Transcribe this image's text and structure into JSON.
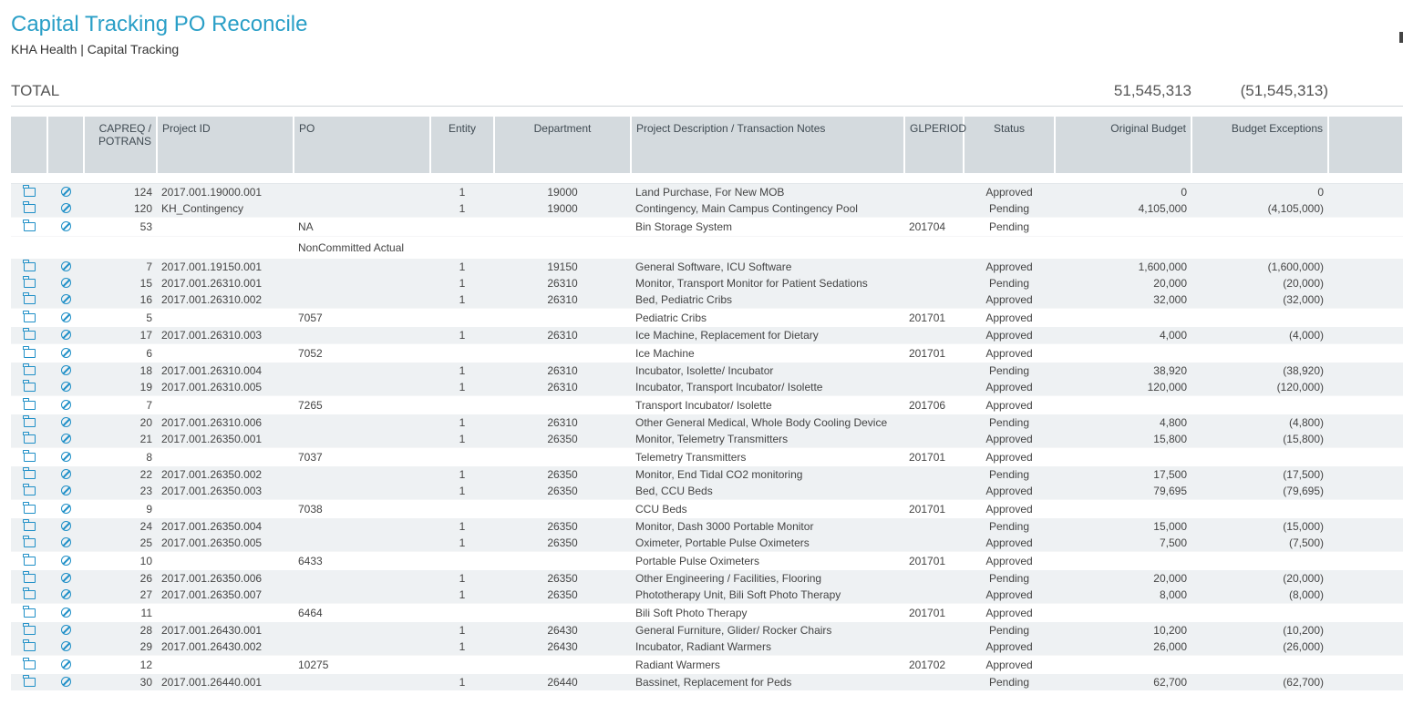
{
  "header": {
    "title": "Capital Tracking PO Reconcile",
    "subtitle": "KHA Health | Capital Tracking"
  },
  "totals": {
    "label": "TOTAL",
    "original_budget": "51,545,313",
    "budget_exceptions": "(51,545,313)"
  },
  "columns": {
    "capreq": "CAPREQ / POTRANS",
    "project_id": "Project ID",
    "po": "PO",
    "entity": "Entity",
    "department": "Department",
    "description": "Project Description / Transaction Notes",
    "glperiod": "GLPERIOD",
    "status": "Status",
    "original_budget": "Original Budget",
    "budget_exceptions": "Budget Exceptions"
  },
  "icons": {
    "open": "folder-open-icon",
    "cancel": "ban-icon",
    "color": "#1e8fc7"
  },
  "rows": [
    {
      "kind": "g",
      "capreq": "124",
      "project_id": "2017.001.19000.001",
      "po": "",
      "entity": "1",
      "department": "19000",
      "description": "Land Purchase, For New MOB",
      "glperiod": "",
      "status": "Approved",
      "original_budget": "0",
      "budget_exceptions": "0"
    },
    {
      "kind": "g",
      "capreq": "120",
      "project_id": "KH_Contingency",
      "po": "",
      "entity": "1",
      "department": "19000",
      "description": "Contingency, Main Campus Contingency Pool",
      "glperiod": "",
      "status": "Pending",
      "original_budget": "4,105,000",
      "budget_exceptions": "(4,105,000)"
    },
    {
      "kind": "w",
      "capreq": "53",
      "project_id": "",
      "po": "NA",
      "entity": "",
      "department": "",
      "description": "Bin Storage System",
      "glperiod": "201704",
      "status": "Pending",
      "original_budget": "",
      "budget_exceptions": ""
    },
    {
      "kind": "n",
      "capreq": "",
      "project_id": "",
      "po": "NonCommitted Actual",
      "entity": "",
      "department": "",
      "description": "",
      "glperiod": "",
      "status": "",
      "original_budget": "",
      "budget_exceptions": ""
    },
    {
      "kind": "g",
      "capreq": "7",
      "project_id": "2017.001.19150.001",
      "po": "",
      "entity": "1",
      "department": "19150",
      "description": "General Software, ICU Software",
      "glperiod": "",
      "status": "Approved",
      "original_budget": "1,600,000",
      "budget_exceptions": "(1,600,000)"
    },
    {
      "kind": "g",
      "capreq": "15",
      "project_id": "2017.001.26310.001",
      "po": "",
      "entity": "1",
      "department": "26310",
      "description": "Monitor, Transport Monitor for Patient Sedations",
      "glperiod": "",
      "status": "Pending",
      "original_budget": "20,000",
      "budget_exceptions": "(20,000)"
    },
    {
      "kind": "g",
      "capreq": "16",
      "project_id": "2017.001.26310.002",
      "po": "",
      "entity": "1",
      "department": "26310",
      "description": "Bed, Pediatric Cribs",
      "glperiod": "",
      "status": "Approved",
      "original_budget": "32,000",
      "budget_exceptions": "(32,000)"
    },
    {
      "kind": "w",
      "capreq": "5",
      "project_id": "",
      "po": "7057",
      "entity": "",
      "department": "",
      "description": "Pediatric Cribs",
      "glperiod": "201701",
      "status": "Approved",
      "original_budget": "",
      "budget_exceptions": ""
    },
    {
      "kind": "g",
      "capreq": "17",
      "project_id": "2017.001.26310.003",
      "po": "",
      "entity": "1",
      "department": "26310",
      "description": "Ice Machine, Replacement for Dietary",
      "glperiod": "",
      "status": "Approved",
      "original_budget": "4,000",
      "budget_exceptions": "(4,000)"
    },
    {
      "kind": "w",
      "capreq": "6",
      "project_id": "",
      "po": "7052",
      "entity": "",
      "department": "",
      "description": "Ice Machine",
      "glperiod": "201701",
      "status": "Approved",
      "original_budget": "",
      "budget_exceptions": ""
    },
    {
      "kind": "g",
      "capreq": "18",
      "project_id": "2017.001.26310.004",
      "po": "",
      "entity": "1",
      "department": "26310",
      "description": "Incubator, Isolette/ Incubator",
      "glperiod": "",
      "status": "Pending",
      "original_budget": "38,920",
      "budget_exceptions": "(38,920)"
    },
    {
      "kind": "g",
      "capreq": "19",
      "project_id": "2017.001.26310.005",
      "po": "",
      "entity": "1",
      "department": "26310",
      "description": "Incubator, Transport Incubator/ Isolette",
      "glperiod": "",
      "status": "Approved",
      "original_budget": "120,000",
      "budget_exceptions": "(120,000)"
    },
    {
      "kind": "w",
      "capreq": "7",
      "project_id": "",
      "po": "7265",
      "entity": "",
      "department": "",
      "description": "Transport Incubator/ Isolette",
      "glperiod": "201706",
      "status": "Approved",
      "original_budget": "",
      "budget_exceptions": ""
    },
    {
      "kind": "g",
      "capreq": "20",
      "project_id": "2017.001.26310.006",
      "po": "",
      "entity": "1",
      "department": "26310",
      "description": "Other General Medical, Whole Body Cooling Device",
      "glperiod": "",
      "status": "Pending",
      "original_budget": "4,800",
      "budget_exceptions": "(4,800)"
    },
    {
      "kind": "g",
      "capreq": "21",
      "project_id": "2017.001.26350.001",
      "po": "",
      "entity": "1",
      "department": "26350",
      "description": "Monitor, Telemetry Transmitters",
      "glperiod": "",
      "status": "Approved",
      "original_budget": "15,800",
      "budget_exceptions": "(15,800)"
    },
    {
      "kind": "w",
      "capreq": "8",
      "project_id": "",
      "po": "7037",
      "entity": "",
      "department": "",
      "description": "Telemetry Transmitters",
      "glperiod": "201701",
      "status": "Approved",
      "original_budget": "",
      "budget_exceptions": ""
    },
    {
      "kind": "g",
      "capreq": "22",
      "project_id": "2017.001.26350.002",
      "po": "",
      "entity": "1",
      "department": "26350",
      "description": "Monitor, End Tidal CO2 monitoring",
      "glperiod": "",
      "status": "Pending",
      "original_budget": "17,500",
      "budget_exceptions": "(17,500)"
    },
    {
      "kind": "g",
      "capreq": "23",
      "project_id": "2017.001.26350.003",
      "po": "",
      "entity": "1",
      "department": "26350",
      "description": "Bed, CCU Beds",
      "glperiod": "",
      "status": "Approved",
      "original_budget": "79,695",
      "budget_exceptions": "(79,695)"
    },
    {
      "kind": "w",
      "capreq": "9",
      "project_id": "",
      "po": "7038",
      "entity": "",
      "department": "",
      "description": "CCU Beds",
      "glperiod": "201701",
      "status": "Approved",
      "original_budget": "",
      "budget_exceptions": ""
    },
    {
      "kind": "g",
      "capreq": "24",
      "project_id": "2017.001.26350.004",
      "po": "",
      "entity": "1",
      "department": "26350",
      "description": "Monitor, Dash 3000 Portable Monitor",
      "glperiod": "",
      "status": "Pending",
      "original_budget": "15,000",
      "budget_exceptions": "(15,000)"
    },
    {
      "kind": "g",
      "capreq": "25",
      "project_id": "2017.001.26350.005",
      "po": "",
      "entity": "1",
      "department": "26350",
      "description": "Oximeter, Portable Pulse Oximeters",
      "glperiod": "",
      "status": "Approved",
      "original_budget": "7,500",
      "budget_exceptions": "(7,500)"
    },
    {
      "kind": "w",
      "capreq": "10",
      "project_id": "",
      "po": "6433",
      "entity": "",
      "department": "",
      "description": "Portable Pulse Oximeters",
      "glperiod": "201701",
      "status": "Approved",
      "original_budget": "",
      "budget_exceptions": ""
    },
    {
      "kind": "g",
      "capreq": "26",
      "project_id": "2017.001.26350.006",
      "po": "",
      "entity": "1",
      "department": "26350",
      "description": "Other Engineering / Facilities, Flooring",
      "glperiod": "",
      "status": "Pending",
      "original_budget": "20,000",
      "budget_exceptions": "(20,000)"
    },
    {
      "kind": "g",
      "capreq": "27",
      "project_id": "2017.001.26350.007",
      "po": "",
      "entity": "1",
      "department": "26350",
      "description": "Phototherapy Unit, Bili Soft Photo Therapy",
      "glperiod": "",
      "status": "Approved",
      "original_budget": "8,000",
      "budget_exceptions": "(8,000)"
    },
    {
      "kind": "w",
      "capreq": "11",
      "project_id": "",
      "po": "6464",
      "entity": "",
      "department": "",
      "description": "Bili Soft Photo Therapy",
      "glperiod": "201701",
      "status": "Approved",
      "original_budget": "",
      "budget_exceptions": ""
    },
    {
      "kind": "g",
      "capreq": "28",
      "project_id": "2017.001.26430.001",
      "po": "",
      "entity": "1",
      "department": "26430",
      "description": "General Furniture, Glider/ Rocker Chairs",
      "glperiod": "",
      "status": "Pending",
      "original_budget": "10,200",
      "budget_exceptions": "(10,200)"
    },
    {
      "kind": "g",
      "capreq": "29",
      "project_id": "2017.001.26430.002",
      "po": "",
      "entity": "1",
      "department": "26430",
      "description": "Incubator, Radiant Warmers",
      "glperiod": "",
      "status": "Approved",
      "original_budget": "26,000",
      "budget_exceptions": "(26,000)"
    },
    {
      "kind": "w",
      "capreq": "12",
      "project_id": "",
      "po": "10275",
      "entity": "",
      "department": "",
      "description": "Radiant Warmers",
      "glperiod": "201702",
      "status": "Approved",
      "original_budget": "",
      "budget_exceptions": ""
    },
    {
      "kind": "g",
      "capreq": "30",
      "project_id": "2017.001.26440.001",
      "po": "",
      "entity": "1",
      "department": "26440",
      "description": "Bassinet, Replacement for Peds",
      "glperiod": "",
      "status": "Pending",
      "original_budget": "62,700",
      "budget_exceptions": "(62,700)"
    }
  ]
}
